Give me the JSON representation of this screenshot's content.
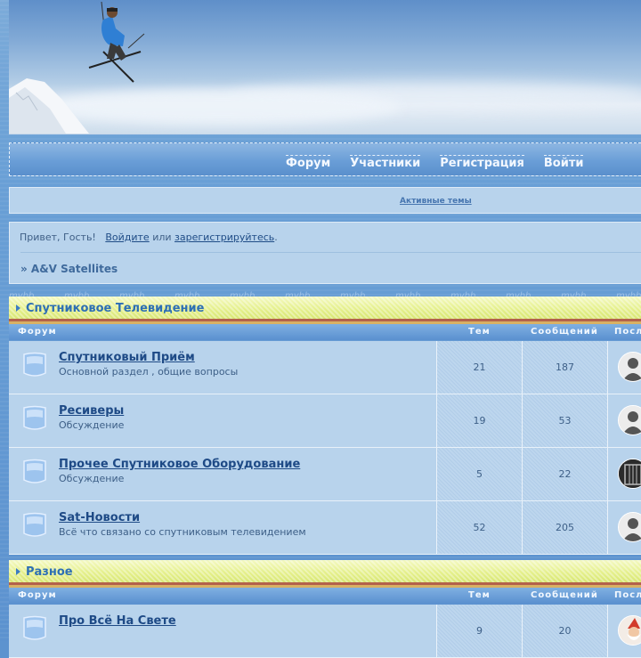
{
  "nav": {
    "items": [
      "Форум",
      "Участники",
      "Регистрация",
      "Войти"
    ]
  },
  "active_topics": "Активные темы",
  "greeting": {
    "prefix": "Привет, Гость!",
    "login": "Войдите",
    "middle": "или",
    "register": "зарегистрируйтесь",
    "suffix": "."
  },
  "breadcrumb": "» A&V Satellites",
  "watermark": "mybb",
  "columns": {
    "forum": "Форум",
    "topics": "Тем",
    "messages": "Сообщений",
    "last": "Посл"
  },
  "categories": [
    {
      "title": "Спутниковое Телевидение",
      "forums": [
        {
          "title": "Спутниковый Приём",
          "desc": "Основной раздел , общие вопросы",
          "topics": "21",
          "messages": "187",
          "avatar": "user-silhouette"
        },
        {
          "title": "Ресиверы",
          "desc": "Обсуждение",
          "topics": "19",
          "messages": "53",
          "avatar": "user-silhouette"
        },
        {
          "title": "Прочее Спутниковое Оборудование",
          "desc": "Обсуждение",
          "topics": "5",
          "messages": "22",
          "avatar": "cage"
        },
        {
          "title": "Sat-Новости",
          "desc": "Всё что связано со спутниковым телевидением",
          "topics": "52",
          "messages": "205",
          "avatar": "user-silhouette"
        }
      ]
    },
    {
      "title": "Разное",
      "forums": [
        {
          "title": "Про Всё На Свете",
          "desc": "",
          "topics": "9",
          "messages": "20",
          "avatar": "gnome"
        }
      ]
    }
  ],
  "colors": {
    "category_bg": "#e5f08c",
    "category_text": "#2d6fb4",
    "row_bg": "#b8d3ec",
    "link": "#1e4a86"
  }
}
